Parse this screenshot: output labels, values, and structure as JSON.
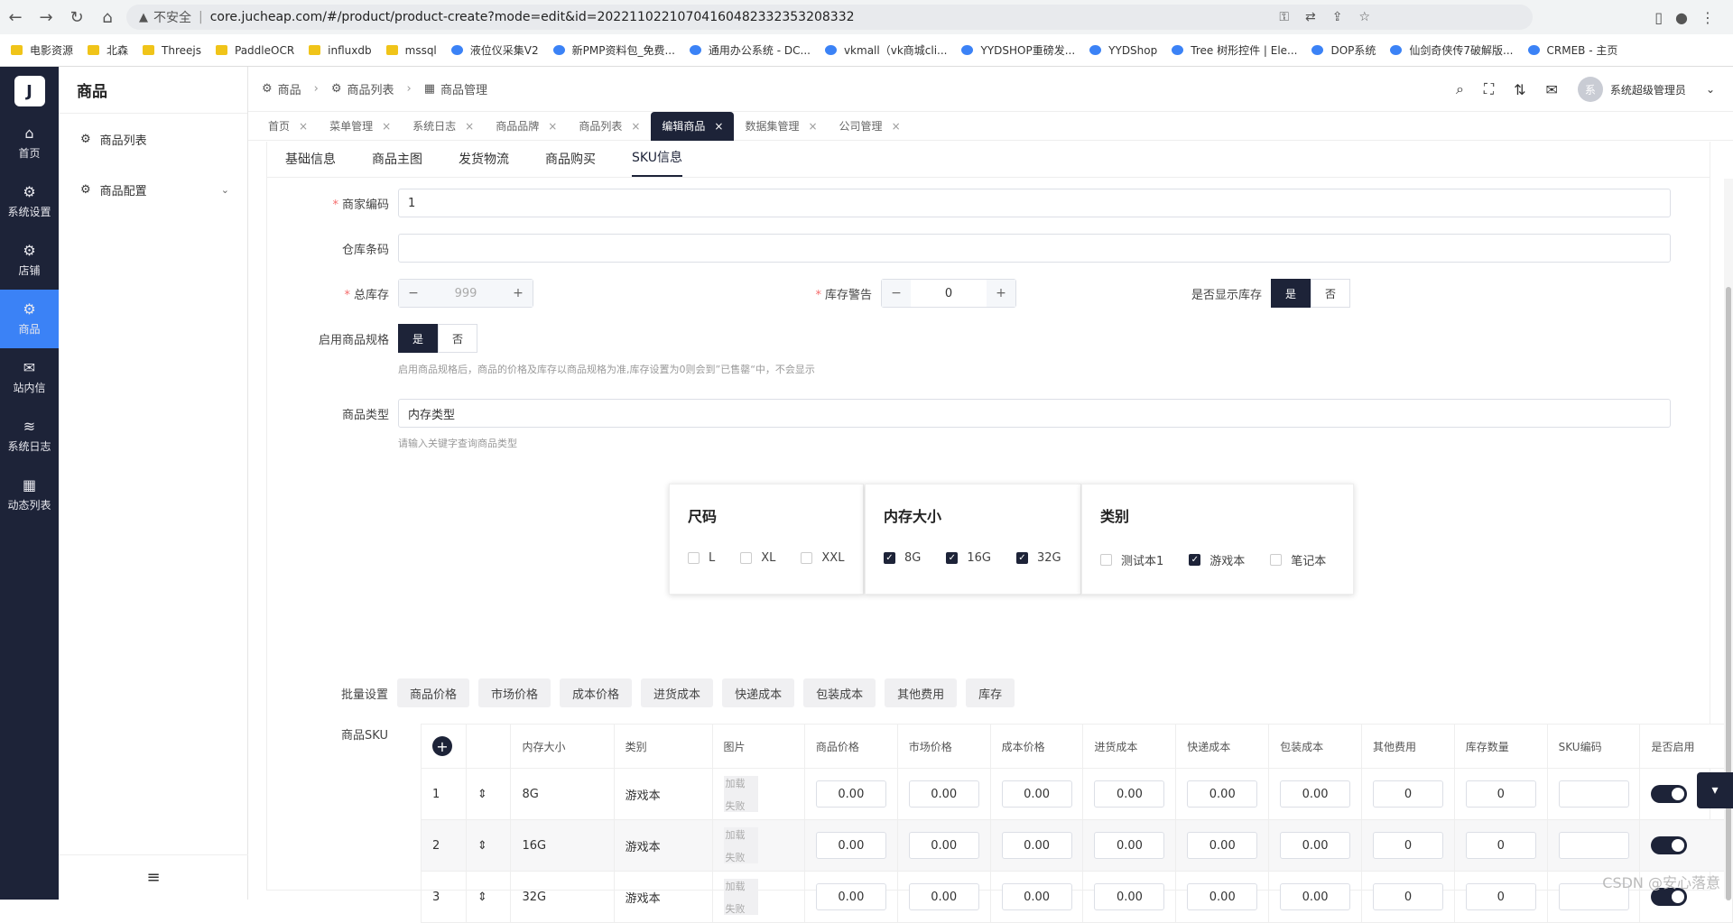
{
  "browser": {
    "security_label": "不安全",
    "url": "core.jucheap.com/#/product/product-create?mode=edit&id=20221102210704160482332353208332",
    "bookmarks": [
      "电影资源",
      "北森",
      "Threejs",
      "PaddleOCR",
      "influxdb",
      "mssql",
      "液位仪采集V2",
      "新PMP资料包_免费...",
      "通用办公系统 - DC...",
      "vkmall（vk商城cli...",
      "YYDSHOP重磅发...",
      "YYDShop",
      "Tree 树形控件 | Ele...",
      "DOP系统",
      "仙剑奇侠传7破解版...",
      "CRMEB - 主页"
    ]
  },
  "rail": {
    "logo": "J",
    "items": [
      {
        "label": "首页",
        "icon": "home-icon"
      },
      {
        "label": "系统设置",
        "icon": "gear-icon"
      },
      {
        "label": "店铺",
        "icon": "gear-icon"
      },
      {
        "label": "商品",
        "icon": "gear-icon"
      },
      {
        "label": "站内信",
        "icon": "mail-icon"
      },
      {
        "label": "系统日志",
        "icon": "database-icon"
      },
      {
        "label": "动态列表",
        "icon": "grid-icon"
      }
    ]
  },
  "sidebar": {
    "title": "商品",
    "items": [
      {
        "label": "商品列表",
        "icon": "gear-icon"
      },
      {
        "label": "商品配置",
        "icon": "gear-icon"
      }
    ]
  },
  "breadcrumb": [
    "商品",
    "商品列表",
    "商品管理"
  ],
  "user": {
    "avatar": "系",
    "name": "系统超级管理员"
  },
  "tabs": [
    "首页",
    "菜单管理",
    "系统日志",
    "商品品牌",
    "商品列表",
    "编辑商品",
    "数据集管理",
    "公司管理"
  ],
  "active_tab": "编辑商品",
  "subtabs": [
    "基础信息",
    "商品主图",
    "发货物流",
    "商品购买",
    "SKU信息"
  ],
  "form": {
    "merchant_code": {
      "label": "商家编码",
      "value": "1"
    },
    "warehouse_barcode": {
      "label": "仓库条码",
      "value": ""
    },
    "total_stock": {
      "label": "总库存",
      "value": "999"
    },
    "stock_warning": {
      "label": "库存警告",
      "value": "0"
    },
    "show_stock": {
      "label": "是否显示库存",
      "yes": "是",
      "no": "否"
    },
    "enable_spec": {
      "label": "启用商品规格",
      "yes": "是",
      "no": "否",
      "hint": "启用商品规格后，商品的价格及库存以商品规格为准,库存设置为0则会到”已售罄“中，不会显示"
    },
    "product_type": {
      "label": "商品类型",
      "value": "内存类型",
      "hint": "请输入关键字查询商品类型"
    },
    "bulk_label": "批量设置",
    "bulk_buttons": [
      "商品价格",
      "市场价格",
      "成本价格",
      "进货成本",
      "快递成本",
      "包装成本",
      "其他费用",
      "库存"
    ],
    "sku_label": "商品SKU"
  },
  "spec_groups": [
    {
      "title": "尺码",
      "options": [
        {
          "label": "L",
          "checked": false
        },
        {
          "label": "XL",
          "checked": false
        },
        {
          "label": "XXL",
          "checked": false
        }
      ]
    },
    {
      "title": "内存大小",
      "options": [
        {
          "label": "8G",
          "checked": true
        },
        {
          "label": "16G",
          "checked": true
        },
        {
          "label": "32G",
          "checked": true
        }
      ]
    },
    {
      "title": "类别",
      "options": [
        {
          "label": "测试本1",
          "checked": false
        },
        {
          "label": "游戏本",
          "checked": true
        },
        {
          "label": "笔记本",
          "checked": false
        }
      ]
    }
  ],
  "sku_table": {
    "headers": [
      "内存大小",
      "类别",
      "图片",
      "商品价格",
      "市场价格",
      "成本价格",
      "进货成本",
      "快递成本",
      "包装成本",
      "其他费用",
      "库存数量",
      "SKU编码",
      "是否启用"
    ],
    "img_placeholder_top": "加载",
    "img_placeholder_bottom": "失败",
    "rows": [
      {
        "idx": "1",
        "memory": "8G",
        "category": "游戏本",
        "price": "0.00",
        "market": "0.00",
        "cost": "0.00",
        "purchase": "0.00",
        "express": "0.00",
        "pack": "0.00",
        "other": "0",
        "stock": "0",
        "sku": "",
        "enabled": true
      },
      {
        "idx": "2",
        "memory": "16G",
        "category": "游戏本",
        "price": "0.00",
        "market": "0.00",
        "cost": "0.00",
        "purchase": "0.00",
        "express": "0.00",
        "pack": "0.00",
        "other": "0",
        "stock": "0",
        "sku": "",
        "enabled": true
      },
      {
        "idx": "3",
        "memory": "32G",
        "category": "游戏本",
        "price": "0.00",
        "market": "0.00",
        "cost": "0.00",
        "purchase": "0.00",
        "express": "0.00",
        "pack": "0.00",
        "other": "0",
        "stock": "0",
        "sku": "",
        "enabled": true
      }
    ]
  },
  "watermark": "CSDN @安心落意",
  "colors": {
    "primary": "#1d2338",
    "accent": "#3b82f6",
    "required": "#f56c6c"
  }
}
